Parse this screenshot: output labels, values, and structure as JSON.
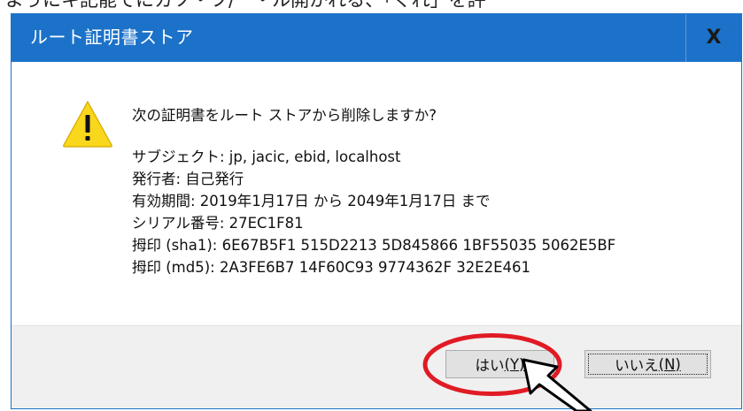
{
  "background_text": "ようにキ記能でにカソ・フ/ー・ル開かれる、「ぐれ」を評",
  "dialog": {
    "title": "ルート証明書ストア",
    "close_label": "X",
    "question": "次の証明書をルート ストアから削除しますか?",
    "details": [
      "サブジェクト: jp, jacic, ebid, localhost",
      "発行者: 自己発行",
      "有効期間: 2019年1月17日 から 2049年1月17日 まで",
      "シリアル番号: 27EC1F81",
      "拇印 (sha1): 6E67B5F1 515D2213 5D845866 1BF55035 5062E5BF",
      "拇印 (md5): 2A3FE6B7 14F60C93 9774362F 32E2E461"
    ],
    "yes_button": {
      "label": "はい",
      "mnemonic": "(Y)"
    },
    "no_button": {
      "label": "いいえ",
      "mnemonic": "(N)"
    }
  },
  "icon": "warning-triangle-icon",
  "colors": {
    "titlebar": "#1c72c9",
    "warning_fill": "#f9d71c",
    "annotation": "#e01b24"
  }
}
